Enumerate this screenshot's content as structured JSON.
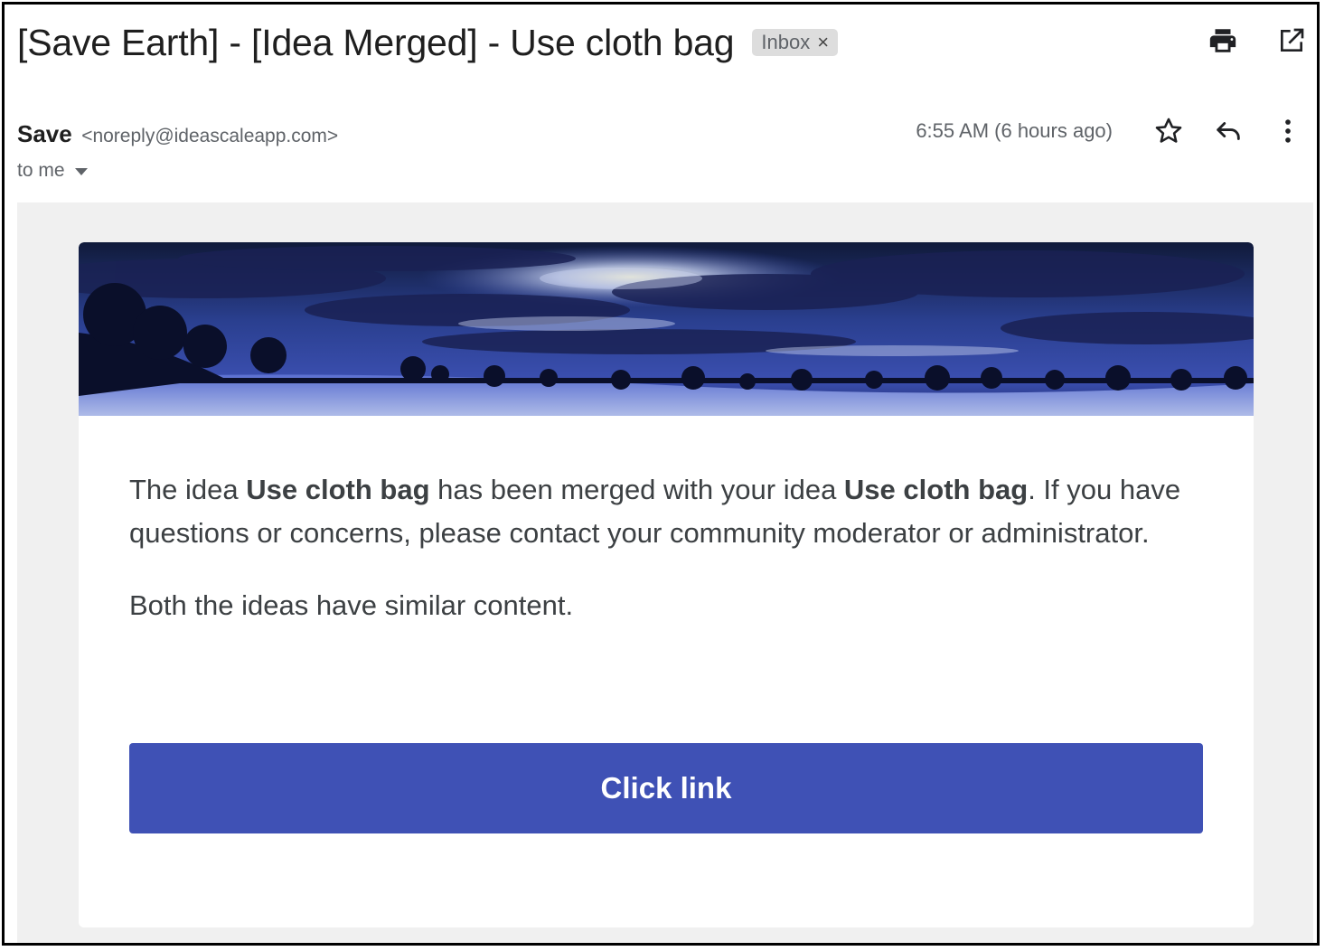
{
  "header": {
    "subject": "[Save Earth] - [Idea Merged] - Use cloth bag",
    "label": "Inbox",
    "label_remove": "×",
    "actions": [
      "print-icon",
      "open-in-new-window-icon"
    ]
  },
  "message": {
    "sender_name": "Save",
    "sender_email": "<noreply@ideascaleapp.com>",
    "recipient": "to me",
    "timestamp": "6:55 AM (6 hours ago)",
    "actions": [
      "star-icon",
      "reply-icon",
      "more-vert-icon"
    ]
  },
  "email_body": {
    "p1_a": "The idea ",
    "p1_idea1": "Use cloth bag",
    "p1_b": " has been merged with your idea ",
    "p1_idea2": "Use cloth bag",
    "p1_c": ". If you have questions or concerns, please contact your community moderator or administrator.",
    "p2": "Both the ideas have similar content.",
    "button_label": "Click link"
  },
  "colors": {
    "button": "#3f51b5",
    "email_background": "#f0f0f0",
    "label_chip": "#dddddd"
  }
}
